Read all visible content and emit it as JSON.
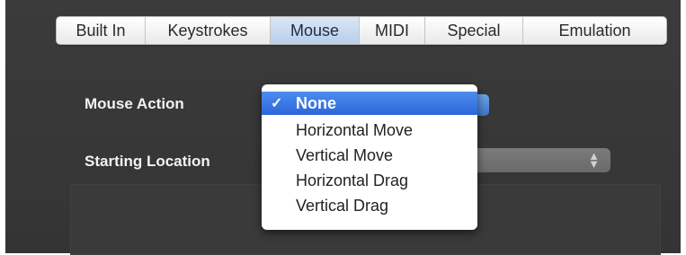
{
  "tabs": [
    {
      "label": "Built In",
      "selected": false
    },
    {
      "label": "Keystrokes",
      "selected": false
    },
    {
      "label": "Mouse",
      "selected": true
    },
    {
      "label": "MIDI",
      "selected": false
    },
    {
      "label": "Special",
      "selected": false
    },
    {
      "label": "Emulation",
      "selected": false
    }
  ],
  "form": {
    "mouse_action_label": "Mouse Action",
    "starting_location_label": "Starting Location",
    "mouse_action_selected": "None"
  },
  "mouse_action_menu": {
    "items": [
      {
        "label": "None",
        "checked": true,
        "highlighted": true
      },
      {
        "label": "Horizontal Move",
        "checked": false,
        "highlighted": false
      },
      {
        "label": "Vertical Move",
        "checked": false,
        "highlighted": false
      },
      {
        "label": "Horizontal Drag",
        "checked": false,
        "highlighted": false
      },
      {
        "label": "Vertical Drag",
        "checked": false,
        "highlighted": false
      }
    ],
    "check_glyph": "✓"
  },
  "icons": {
    "stepper": "up-down-arrows-icon"
  },
  "colors": {
    "background": "#383838",
    "selected_tab": "#c8d8ee",
    "menu_highlight": "#2f6fdc"
  }
}
